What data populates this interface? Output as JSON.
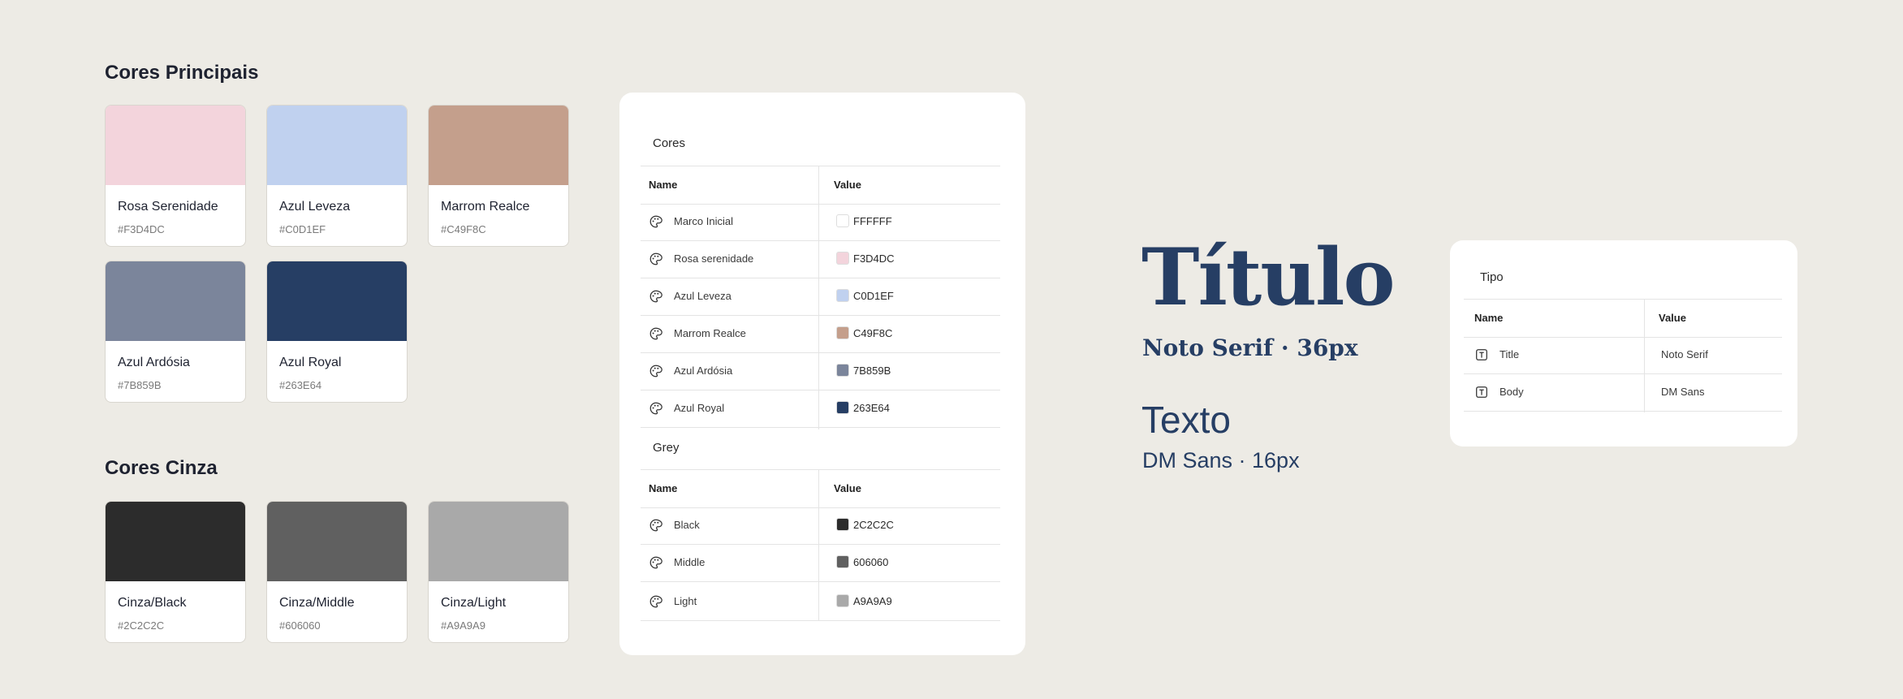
{
  "principal": {
    "title": "Cores Principais",
    "swatches": [
      {
        "name": "Rosa Serenidade",
        "hex": "#F3D4DC",
        "color": "#F3D4DC"
      },
      {
        "name": "Azul Leveza",
        "hex": "#C0D1EF",
        "color": "#C0D1EF"
      },
      {
        "name": "Marrom Realce",
        "hex": "#C49F8C",
        "color": "#C49F8C"
      },
      {
        "name": "Azul Ardósia",
        "hex": "#7B859B",
        "color": "#7B859B"
      },
      {
        "name": "Azul Royal",
        "hex": "#263E64",
        "color": "#263E64"
      }
    ]
  },
  "cinza": {
    "title": "Cores Cinza",
    "swatches": [
      {
        "name": "Cinza/Black",
        "hex": "#2C2C2C",
        "color": "#2C2C2C"
      },
      {
        "name": "Cinza/Middle",
        "hex": "#606060",
        "color": "#606060"
      },
      {
        "name": "Cinza/Light",
        "hex": "#A9A9A9",
        "color": "#A9A9A9"
      }
    ]
  },
  "variables": {
    "cores": {
      "heading": "Cores",
      "col_name": "Name",
      "col_value": "Value",
      "rows": [
        {
          "name": "Marco Inicial",
          "value": "FFFFFF",
          "color": "#FFFFFF",
          "icon": "palette-icon"
        },
        {
          "name": "Rosa serenidade",
          "value": "F3D4DC",
          "color": "#F3D4DC",
          "icon": "palette-icon"
        },
        {
          "name": "Azul Leveza",
          "value": "C0D1EF",
          "color": "#C0D1EF",
          "icon": "palette-icon"
        },
        {
          "name": "Marrom Realce",
          "value": "C49F8C",
          "color": "#C49F8C",
          "icon": "palette-icon"
        },
        {
          "name": "Azul Ardósia",
          "value": "7B859B",
          "color": "#7B859B",
          "icon": "palette-icon"
        },
        {
          "name": "Azul Royal",
          "value": "263E64",
          "color": "#263E64",
          "icon": "palette-icon"
        }
      ]
    },
    "grey": {
      "heading": "Grey",
      "col_name": "Name",
      "col_value": "Value",
      "rows": [
        {
          "name": "Black",
          "value": "2C2C2C",
          "color": "#2C2C2C",
          "icon": "palette-icon"
        },
        {
          "name": "Middle",
          "value": "606060",
          "color": "#606060",
          "icon": "palette-icon"
        },
        {
          "name": "Light",
          "value": "A9A9A9",
          "color": "#A9A9A9",
          "icon": "palette-icon"
        }
      ]
    }
  },
  "typography": {
    "title_sample": "Título",
    "title_spec": "Noto Serif · 36px",
    "text_sample": "Texto",
    "text_spec": "DM Sans · 16px",
    "accent_color": "#263E64"
  },
  "tipo": {
    "heading": "Tipo",
    "col_name": "Name",
    "col_value": "Value",
    "rows": [
      {
        "name": "Title",
        "value": "Noto Serif",
        "icon": "text-style-icon"
      },
      {
        "name": "Body",
        "value": "DM Sans",
        "icon": "text-style-icon"
      }
    ]
  }
}
